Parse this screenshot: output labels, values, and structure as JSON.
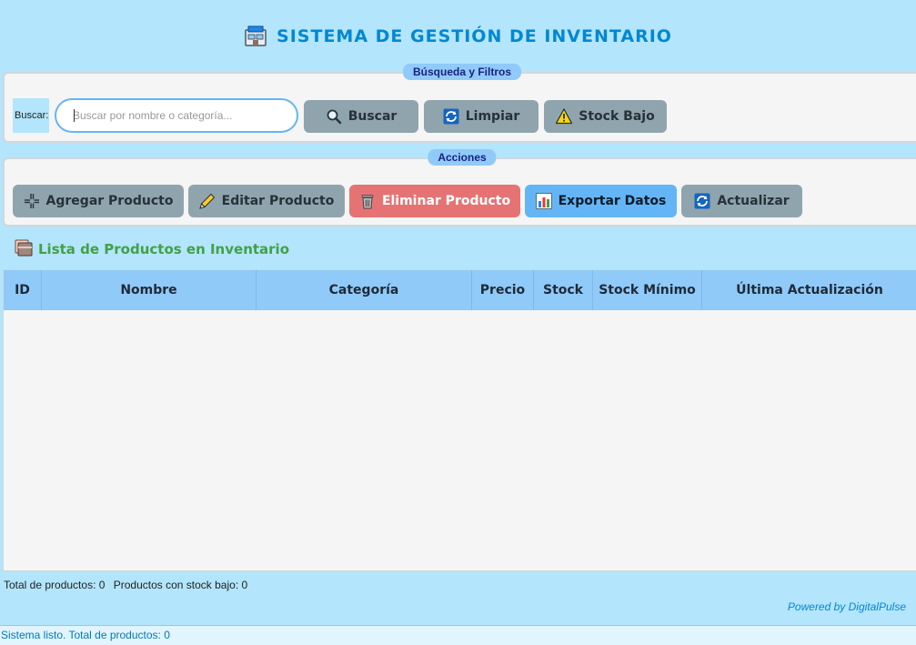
{
  "header": {
    "title": "SISTEMA DE GESTIÓN DE INVENTARIO",
    "icon": "store-icon"
  },
  "search_frame": {
    "legend": "Búsqueda y Filtros",
    "label": "Buscar:",
    "input_value": "",
    "input_placeholder": "Buscar por nombre o categoría...",
    "buttons": {
      "search": {
        "label": "Buscar",
        "icon": "magnifier-icon"
      },
      "clear": {
        "label": "Limpiar",
        "icon": "refresh-icon"
      },
      "low_stock": {
        "label": "Stock Bajo",
        "icon": "warning-icon"
      }
    }
  },
  "actions_frame": {
    "legend": "Acciones",
    "buttons": {
      "add": {
        "label": "Agregar Producto",
        "icon": "plus-cross-icon"
      },
      "edit": {
        "label": "Editar Producto",
        "icon": "pencil-icon"
      },
      "delete": {
        "label": "Eliminar Producto",
        "icon": "trash-icon"
      },
      "export": {
        "label": "Exportar Datos",
        "icon": "bar-chart-icon"
      },
      "refresh": {
        "label": "Actualizar",
        "icon": "refresh-icon"
      }
    }
  },
  "product_list": {
    "title": "Lista de Productos en Inventario",
    "columns": [
      "ID",
      "Nombre",
      "Categoría",
      "Precio",
      "Stock",
      "Stock Mínimo",
      "Última Actualización"
    ],
    "rows": []
  },
  "summary": {
    "total": "Total de productos: 0",
    "low_stock": "Productos con stock bajo: 0"
  },
  "footer": {
    "powered_by": "Powered by DigitalPulse"
  },
  "status_bar": {
    "text": "Sistema listo. Total de productos: 0"
  },
  "colors": {
    "background": "#b3e5fc",
    "accent": "#0288d1",
    "button_default": "#90a4ae",
    "button_danger": "#e57373",
    "button_info": "#64b5f6",
    "table_header": "#90caf9",
    "list_title": "#43a047"
  }
}
